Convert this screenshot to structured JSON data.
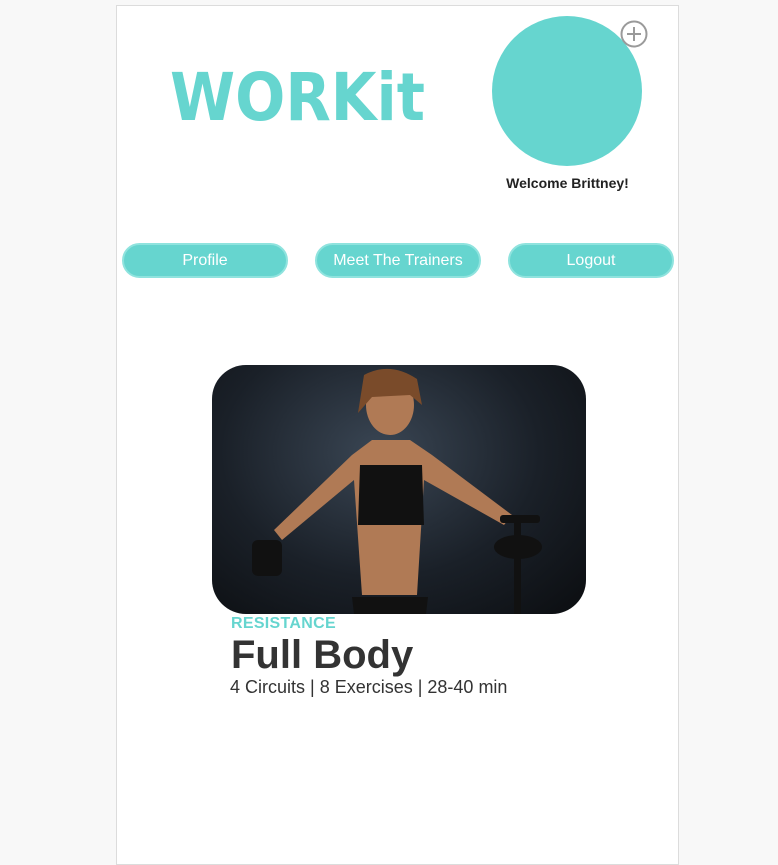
{
  "brand": {
    "logo_text": "WORKit",
    "accent_color": "#66d5cf"
  },
  "header": {
    "avatar_icon": "avatar",
    "add_icon": "plus-circle-icon",
    "welcome_text": "Welcome Brittney!"
  },
  "nav": {
    "profile_label": "Profile",
    "trainers_label": "Meet The Trainers",
    "logout_label": "Logout"
  },
  "workout": {
    "category": "RESISTANCE",
    "title": "Full Body",
    "details": "4 Circuits | 8 Exercises | 28-40 min"
  }
}
